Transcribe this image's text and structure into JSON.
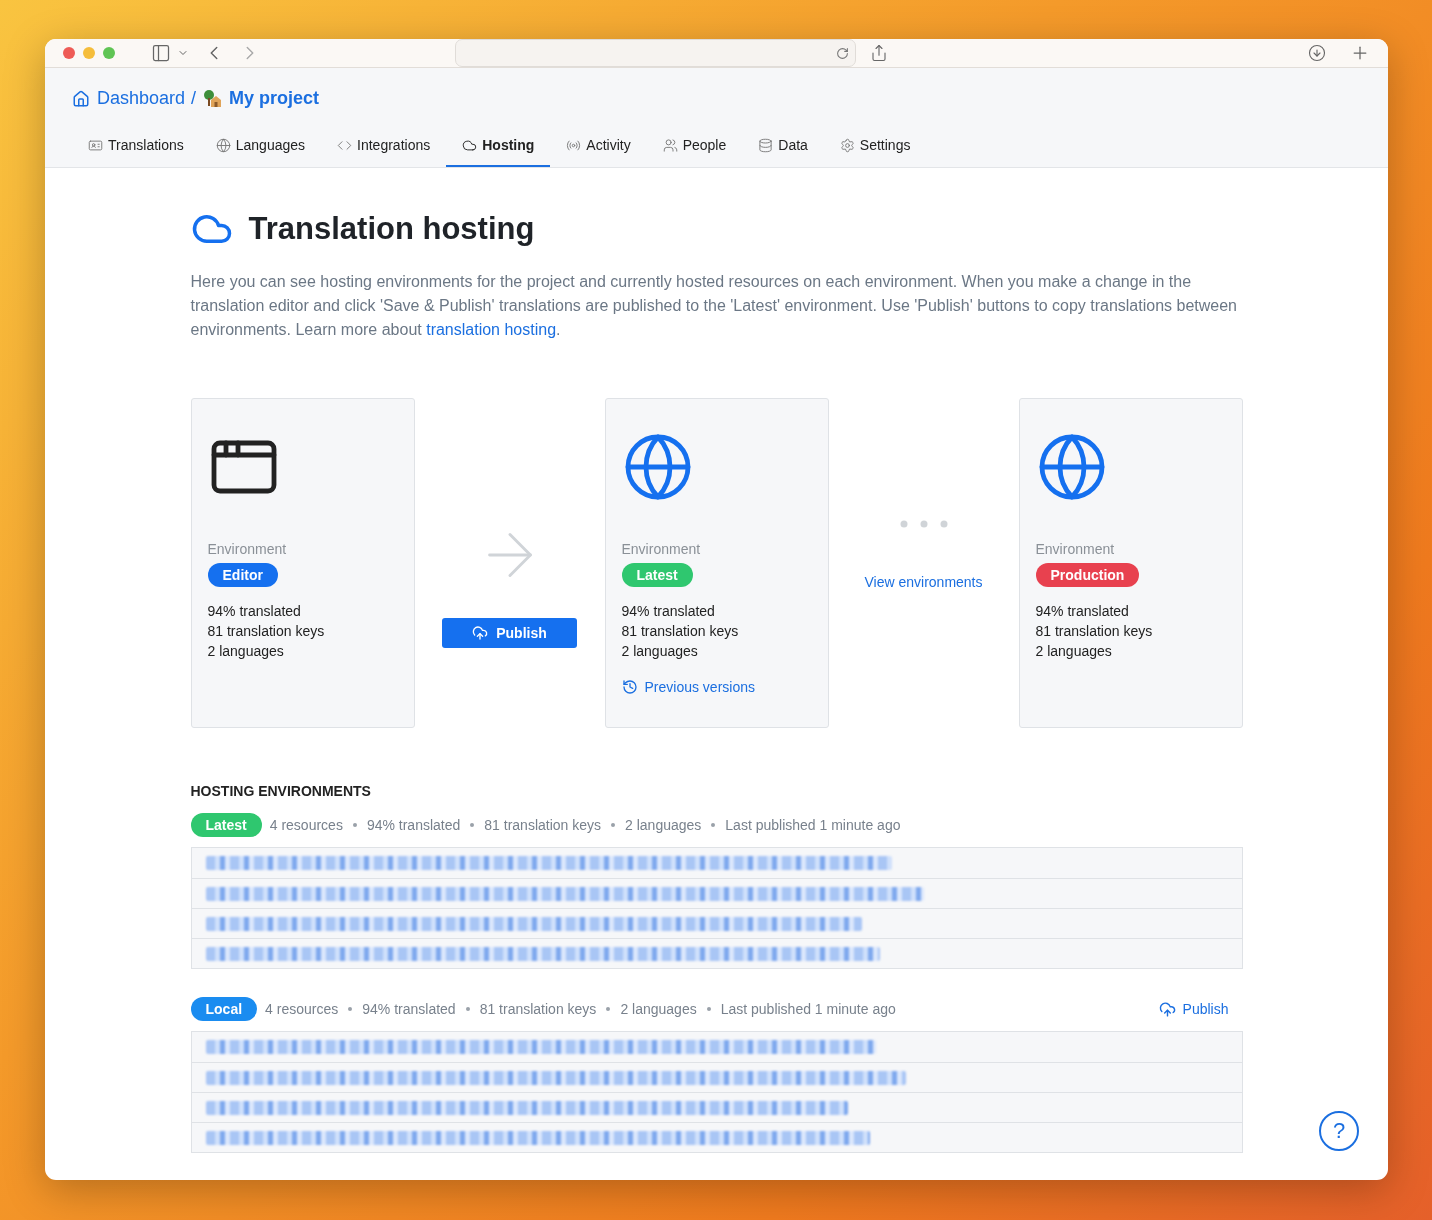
{
  "breadcrumb": [
    {
      "label": "Dashboard",
      "kind": "home"
    },
    {
      "label": "My project",
      "kind": "project"
    }
  ],
  "breadcrumb_separator": "/",
  "tabs": [
    {
      "label": "Translations",
      "selected": false
    },
    {
      "label": "Languages",
      "selected": false
    },
    {
      "label": "Integrations",
      "selected": false
    },
    {
      "label": "Hosting",
      "selected": true
    },
    {
      "label": "Activity",
      "selected": false
    },
    {
      "label": "People",
      "selected": false
    },
    {
      "label": "Data",
      "selected": false
    },
    {
      "label": "Settings",
      "selected": false
    }
  ],
  "page": {
    "title": "Translation hosting",
    "intro": "Here you can see hosting environments for the project and currently hosted resources on each environment. When you make a change in the translation editor and click 'Save & Publish' translations are published to the 'Latest' environment. Use 'Publish' buttons to copy translations between environments. Learn more about ",
    "intro_link": "translation hosting",
    "intro_end": "."
  },
  "environments": [
    {
      "kind": "editor",
      "caption": "Environment",
      "badge": {
        "label": "Editor",
        "color": "#1570ef"
      },
      "stats": [
        "94% translated",
        "81 translation keys",
        "2 languages"
      ]
    },
    {
      "kind": "hosted",
      "caption": "Environment",
      "badge": {
        "label": "Latest",
        "color": "#2fc76f"
      },
      "stats": [
        "94% translated",
        "81 translation keys",
        "2 languages"
      ],
      "link": "Previous versions"
    },
    {
      "kind": "hosted",
      "caption": "Environment",
      "badge": {
        "label": "Production",
        "color": "#e8414f"
      },
      "stats": [
        "94% translated",
        "81 translation keys",
        "2 languages"
      ]
    }
  ],
  "connectors": [
    {
      "kind": "publish",
      "label": "Publish"
    },
    {
      "kind": "link",
      "label": "View environments"
    }
  ],
  "hosting_environments": {
    "heading": "HOSTING ENVIRONMENTS",
    "groups": [
      {
        "badge": {
          "label": "Latest",
          "color": "#2fc76f"
        },
        "meta": [
          "4 resources",
          "94% translated",
          "81 translation keys",
          "2 languages",
          "Last published 1 minute ago"
        ],
        "rows": [
          {
            "kind": "redacted"
          },
          {
            "kind": "redacted"
          },
          {
            "kind": "redacted"
          },
          {
            "kind": "redacted"
          }
        ]
      },
      {
        "badge": {
          "label": "Local",
          "color": "#1a8cf0"
        },
        "meta": [
          "4 resources",
          "94% translated",
          "81 translation keys",
          "2 languages",
          "Last published 1 minute ago"
        ],
        "action": "Publish",
        "rows": [
          {
            "kind": "redacted"
          },
          {
            "kind": "redacted"
          },
          {
            "kind": "redacted"
          },
          {
            "kind": "redacted"
          }
        ]
      }
    ]
  },
  "help_button": "?"
}
